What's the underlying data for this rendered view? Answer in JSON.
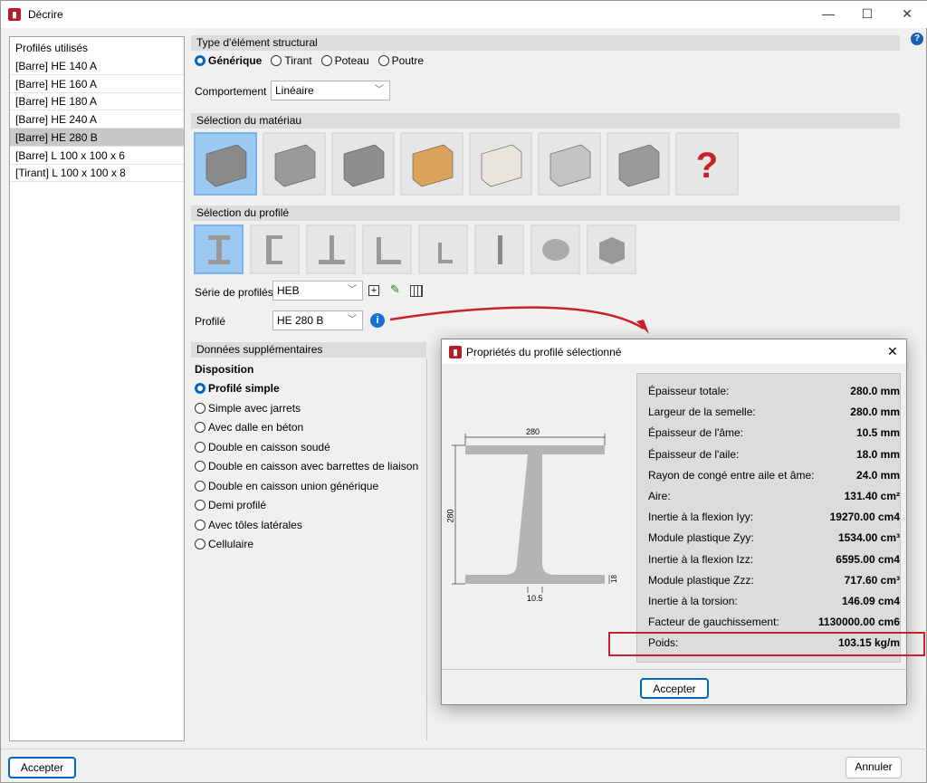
{
  "window": {
    "title": "Décrire",
    "help_icon": "?"
  },
  "profiles_list": {
    "header": "Profilés utilisés",
    "items": [
      "[Barre] HE 140 A",
      "[Barre] HE 160 A",
      "[Barre] HE 180 A",
      "[Barre] HE 240 A",
      "[Barre] HE 280 B",
      "[Barre] L 100 x 100 x 6",
      "[Tirant] L 100 x 100 x 8"
    ],
    "selected_index": 4
  },
  "structural_type": {
    "header": "Type d'élément structural",
    "options": [
      "Générique",
      "Tirant",
      "Poteau",
      "Poutre"
    ],
    "selected": "Générique"
  },
  "behavior": {
    "label": "Comportement",
    "value": "Linéaire"
  },
  "material": {
    "header": "Sélection du matériau",
    "items": [
      "steel-rolled",
      "steel-welded",
      "cold-formed",
      "wood",
      "aluminium-generic",
      "aluminium-extruded",
      "concrete",
      "generic-unknown"
    ],
    "selected_index": 0
  },
  "profile_selection": {
    "header": "Sélection du profilé",
    "items": [
      "I-section",
      "C-section",
      "T-section",
      "L-section",
      "small-L",
      "plate",
      "round-bar",
      "box"
    ],
    "selected_index": 0
  },
  "series": {
    "label": "Série de profilés",
    "value": "HEB"
  },
  "profile": {
    "label": "Profilé",
    "value": "HE 280 B"
  },
  "extra": {
    "header": "Données supplémentaires",
    "disposition_label": "Disposition",
    "options": [
      "Profilé simple",
      "Simple avec jarrets",
      "Avec dalle en béton",
      "Double en caisson soudé",
      "Double en caisson avec barrettes de liaison",
      "Double en caisson union générique",
      "Demi profilé",
      "Avec tôles latérales",
      "Cellulaire"
    ],
    "selected": "Profilé simple"
  },
  "footer": {
    "accept": "Accepter",
    "cancel": "Annuler"
  },
  "dialog": {
    "title": "Propriétés du profilé sélectionné",
    "accept": "Accepter",
    "drawing": {
      "width": "280",
      "height": "280",
      "web": "10.5",
      "flange": "18"
    },
    "properties": [
      {
        "label": "Épaisseur totale:",
        "value": "280.0 mm"
      },
      {
        "label": "Largeur de la semelle:",
        "value": "280.0 mm"
      },
      {
        "label": "Épaisseur de l'âme:",
        "value": "10.5 mm"
      },
      {
        "label": "Épaisseur de l'aile:",
        "value": "18.0 mm"
      },
      {
        "label": "Rayon de congé entre aile et âme:",
        "value": "24.0 mm"
      },
      {
        "label": "Aire:",
        "value": "131.40 cm²"
      },
      {
        "label": "Inertie à la flexion Iyy:",
        "value": "19270.00 cm4"
      },
      {
        "label": "Module plastique Zyy:",
        "value": "1534.00 cm³"
      },
      {
        "label": "Inertie à la flexion Izz:",
        "value": "6595.00 cm4"
      },
      {
        "label": "Module plastique Zzz:",
        "value": "717.60 cm³"
      },
      {
        "label": "Inertie à la torsion:",
        "value": "146.09 cm4"
      },
      {
        "label": "Facteur de gauchissement:",
        "value": "1130000.00 cm6"
      },
      {
        "label": "Poids:",
        "value": "103.15 kg/m"
      }
    ]
  },
  "colors": {
    "accent": "#0067c0",
    "highlight": "#c8202c"
  }
}
